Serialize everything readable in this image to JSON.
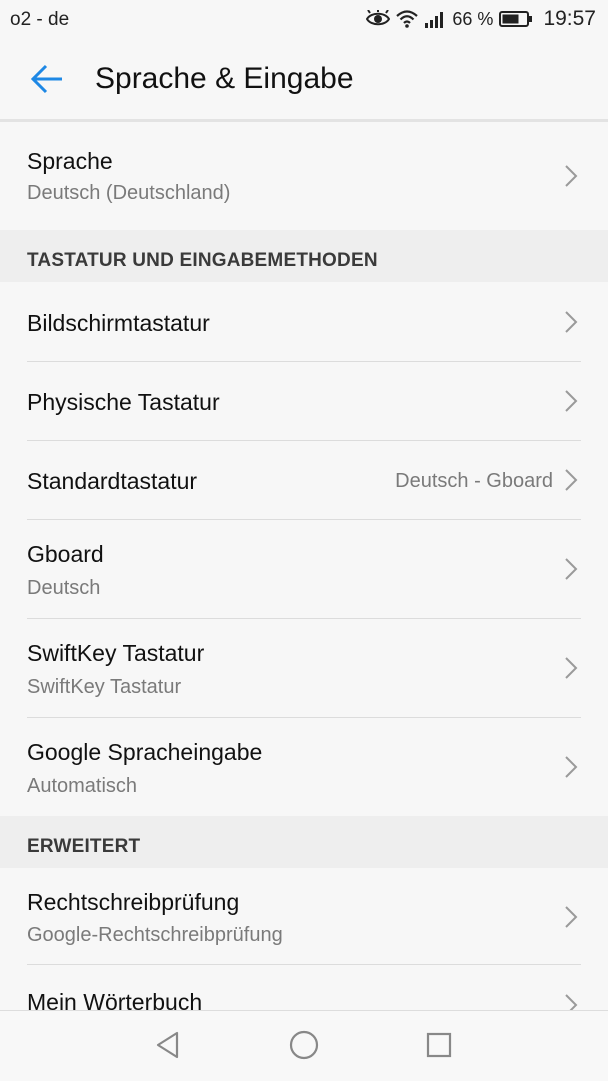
{
  "status_bar": {
    "carrier": "o2 - de",
    "battery_percent": "66 %",
    "time": "19:57",
    "icons": [
      "eye-icon",
      "wifi-icon",
      "signal-icon",
      "battery-icon"
    ]
  },
  "header": {
    "title": "Sprache & Eingabe",
    "back_icon": "arrow-back-icon",
    "accent_color": "#1e88e5"
  },
  "language_row": {
    "title": "Sprache",
    "subtitle": "Deutsch (Deutschland)"
  },
  "sections": [
    {
      "header": "TASTATUR UND EINGABEMETHODEN",
      "items": [
        {
          "title": "Bildschirmtastatur"
        },
        {
          "title": "Physische Tastatur"
        },
        {
          "title": "Standardtastatur",
          "value": "Deutsch - Gboard"
        },
        {
          "title": "Gboard",
          "subtitle": "Deutsch"
        },
        {
          "title": "SwiftKey Tastatur",
          "subtitle": "SwiftKey Tastatur"
        },
        {
          "title": "Google Spracheingabe",
          "subtitle": "Automatisch"
        }
      ]
    },
    {
      "header": "ERWEITERT",
      "items": [
        {
          "title": "Rechtschreibprüfung",
          "subtitle": "Google-Rechtschreibprüfung"
        },
        {
          "title": "Mein Wörterbuch"
        }
      ]
    }
  ],
  "nav_bar": {
    "icons": [
      "back-triangle-icon",
      "home-circle-icon",
      "recents-square-icon"
    ]
  }
}
